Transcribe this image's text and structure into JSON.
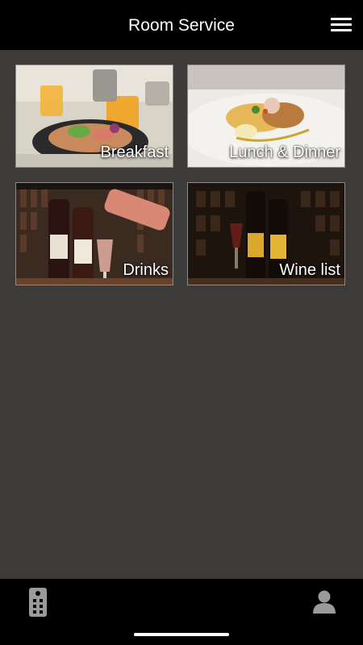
{
  "header": {
    "title": "Room Service",
    "menu_icon": "hamburger-menu-icon"
  },
  "tiles": [
    {
      "label": "Breakfast",
      "image": "breakfast-photo"
    },
    {
      "label": "Lunch & Dinner",
      "image": "lunch-dinner-photo"
    },
    {
      "label": "Drinks",
      "image": "drinks-photo"
    },
    {
      "label": "Wine list",
      "image": "wine-list-photo"
    }
  ],
  "bottom_bar": {
    "left_icon": "remote-control-icon",
    "right_icon": "user-profile-icon"
  },
  "colors": {
    "background": "#3c3b3a",
    "bars": "#000000",
    "text": "#ffffff"
  }
}
